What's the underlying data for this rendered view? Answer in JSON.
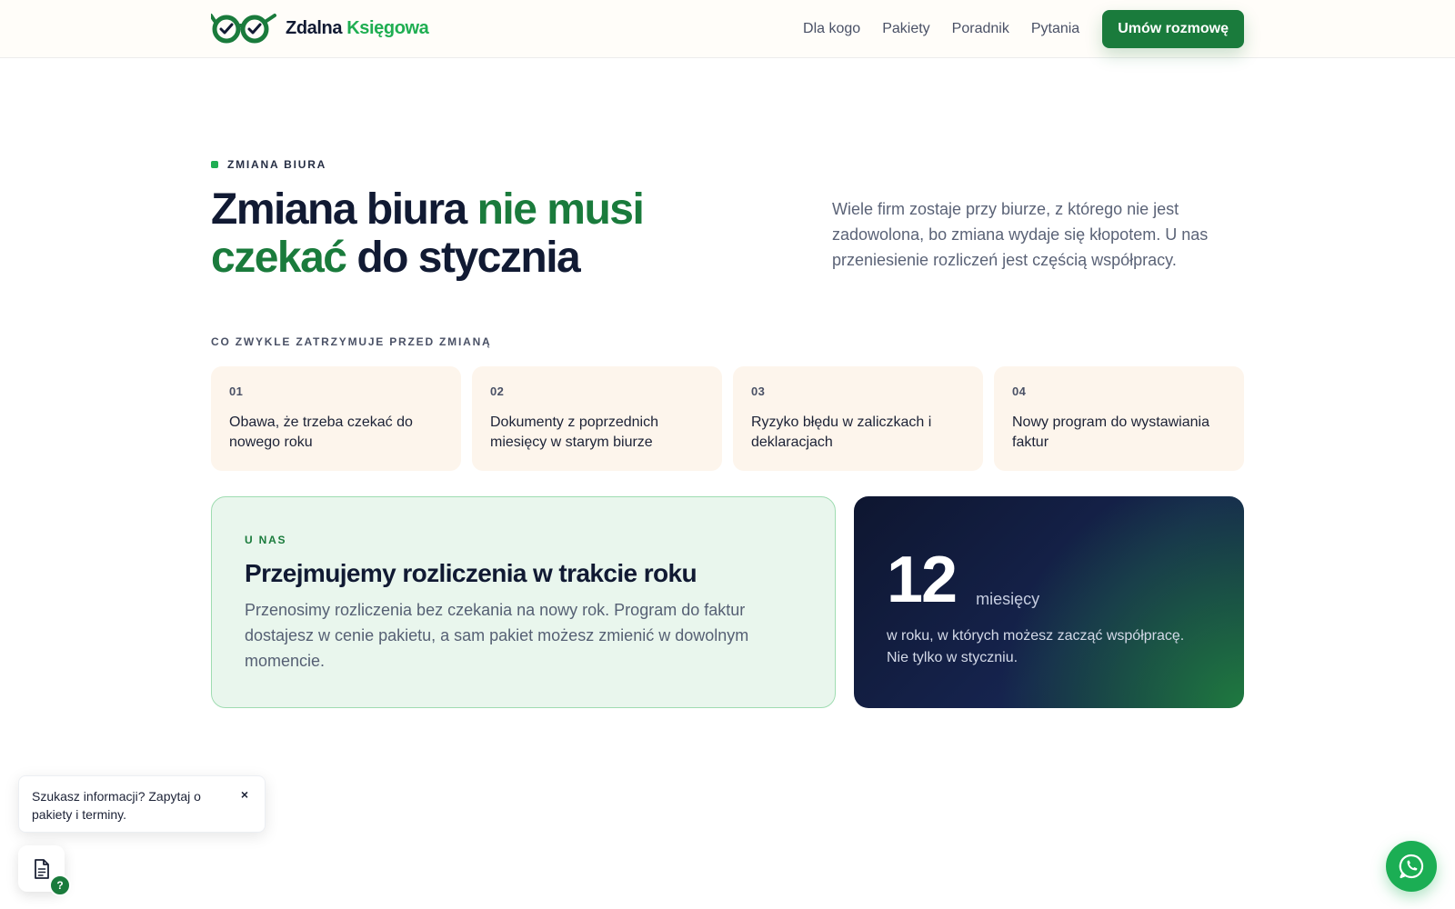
{
  "header": {
    "brand_main": "Zdalna",
    "brand_accent": "Księgowa",
    "nav": [
      {
        "label": "Dla kogo"
      },
      {
        "label": "Pakiety"
      },
      {
        "label": "Poradnik"
      },
      {
        "label": "Pytania"
      }
    ],
    "cta_label": "Umów rozmowę"
  },
  "section": {
    "eyebrow": "ZMIANA BIURA",
    "title_part1": "Zmiana biura ",
    "title_part2_green": "nie musi czekać",
    "title_part3": " do stycznia",
    "lead": "Wiele firm zostaje przy biurze, z którego nie jest zadowolona, bo zmiana wydaje się kłopotem. U nas przeniesienie rozliczeń jest częścią współpracy.",
    "list_label": "CO ZWYKLE ZATRZYMUJE PRZED ZMIANĄ",
    "cards": [
      {
        "num": "01",
        "text": "Obawa, że trzeba czekać do nowego roku"
      },
      {
        "num": "02",
        "text": "Dokumenty z poprzednich miesięcy w starym biurze"
      },
      {
        "num": "03",
        "text": "Ryzyko błędu w zaliczkach i deklaracjach"
      },
      {
        "num": "04",
        "text": "Nowy program do wystawiania faktur"
      }
    ],
    "us": {
      "kicker": "U NAS",
      "heading": "Przejmujemy rozliczenia w trakcie roku",
      "body": "Przenosimy rozliczenia bez czekania na nowy rok. Program do faktur dostajesz w cenie pakietu, a sam pakiet możesz zmienić w dowolnym momencie."
    },
    "stat": {
      "value": "12",
      "unit": "miesięcy",
      "desc": "w roku, w których możesz zacząć współpracę. Nie tylko w styczniu."
    }
  },
  "widget": {
    "tip_text": "Szukasz informacji? Zapytaj o pakiety i terminy.",
    "close_glyph": "×",
    "badge": "?"
  },
  "colors": {
    "accent": "#1a7b3c",
    "accent_light": "#1fae52",
    "navy": "#111a33",
    "whatsapp": "#1bae54"
  },
  "icons": [
    "logo-glasses-icon",
    "document-icon",
    "whatsapp-icon",
    "close-icon"
  ]
}
